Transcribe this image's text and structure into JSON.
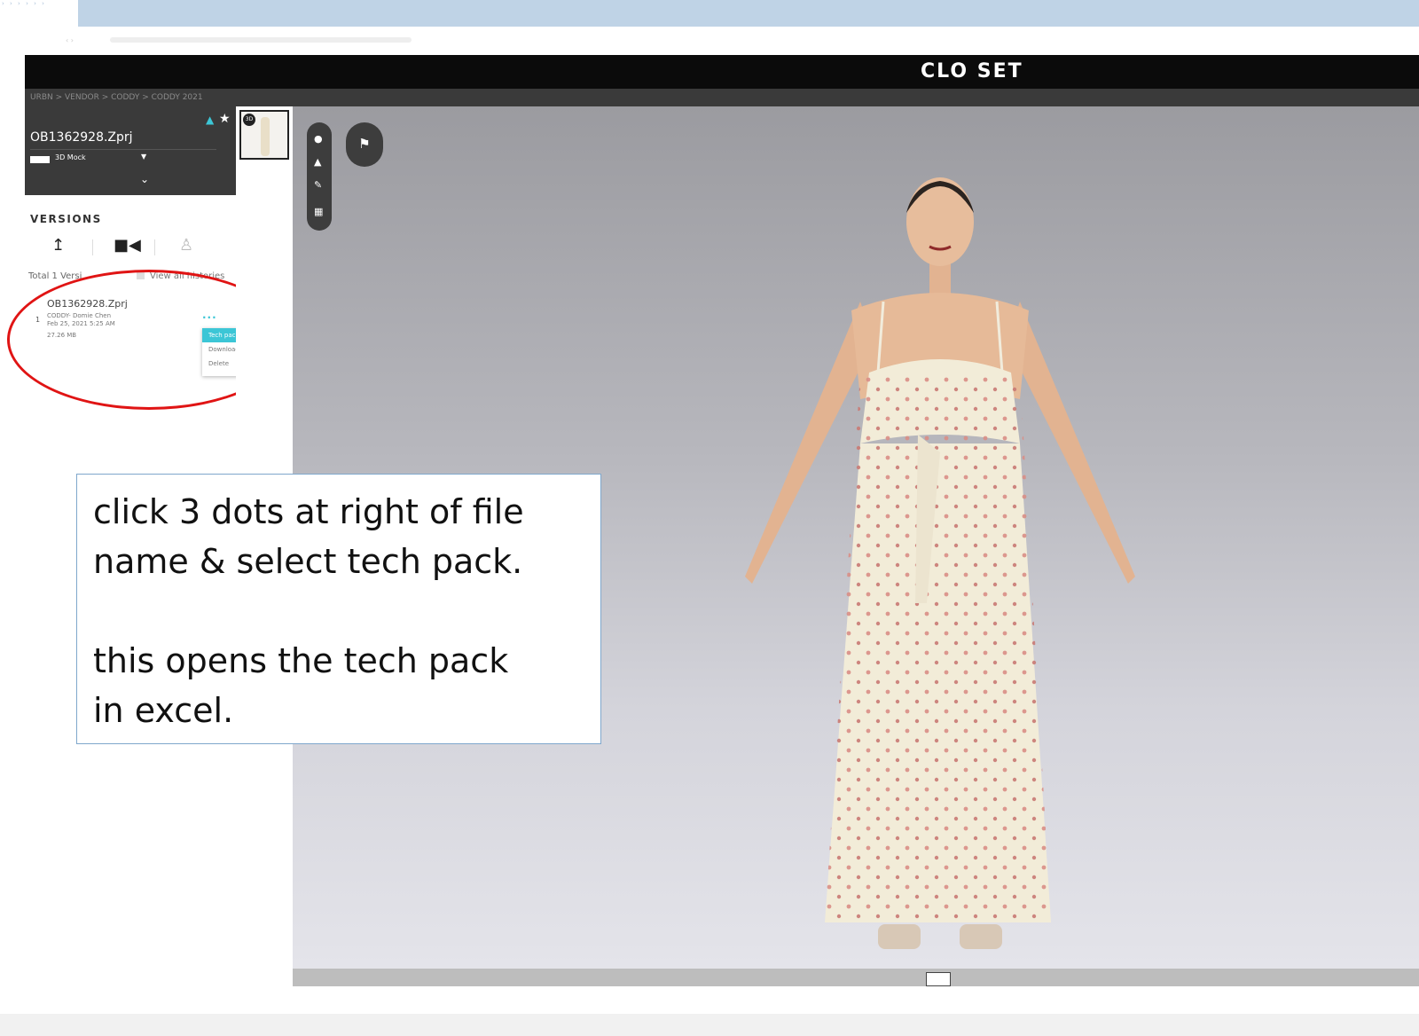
{
  "app": {
    "logo": "CLO SET",
    "breadcrumb": "URBN > VENDOR > CODDY > CODDY 2021"
  },
  "file": {
    "name": "OB1362928.Zprj",
    "view_mode": "3D Mock"
  },
  "versions": {
    "title": "VERSIONS",
    "total": "Total 1 Versi",
    "view_all": "View all histories",
    "items": [
      {
        "number": "1",
        "file_name": "OB1362928.Zprj",
        "author": "CODDY- Domie Chen",
        "date": "Feb 25, 2021 5:25 AM",
        "size": "27.26 MB",
        "more": "..."
      }
    ]
  },
  "context_menu": {
    "items": [
      "Tech pack",
      "Download",
      "Delete"
    ],
    "active": "Tech pack"
  },
  "thumbnail": {
    "badge": "3D"
  },
  "callout": {
    "line1": "click 3 dots at right of file",
    "line2": "name & select tech pack.",
    "line3": "this opens the tech pack",
    "line4": "in excel."
  },
  "colors": {
    "accent": "#3cc6d6",
    "header_bg": "#0b0b0b",
    "sidebar_card_bg": "#3a3a3a",
    "highlight_ellipse": "#e01414",
    "callout_border": "#7fa7cc"
  },
  "icons": {
    "upload": "upload-icon",
    "video": "video-camera-icon",
    "tree": "hanger-icon",
    "avatar_tool": "avatar-icon",
    "garment_tool": "shirt-icon",
    "pen_tool": "pen-icon",
    "export_tool": "export-icon",
    "garment_list": "garment-list-icon"
  }
}
